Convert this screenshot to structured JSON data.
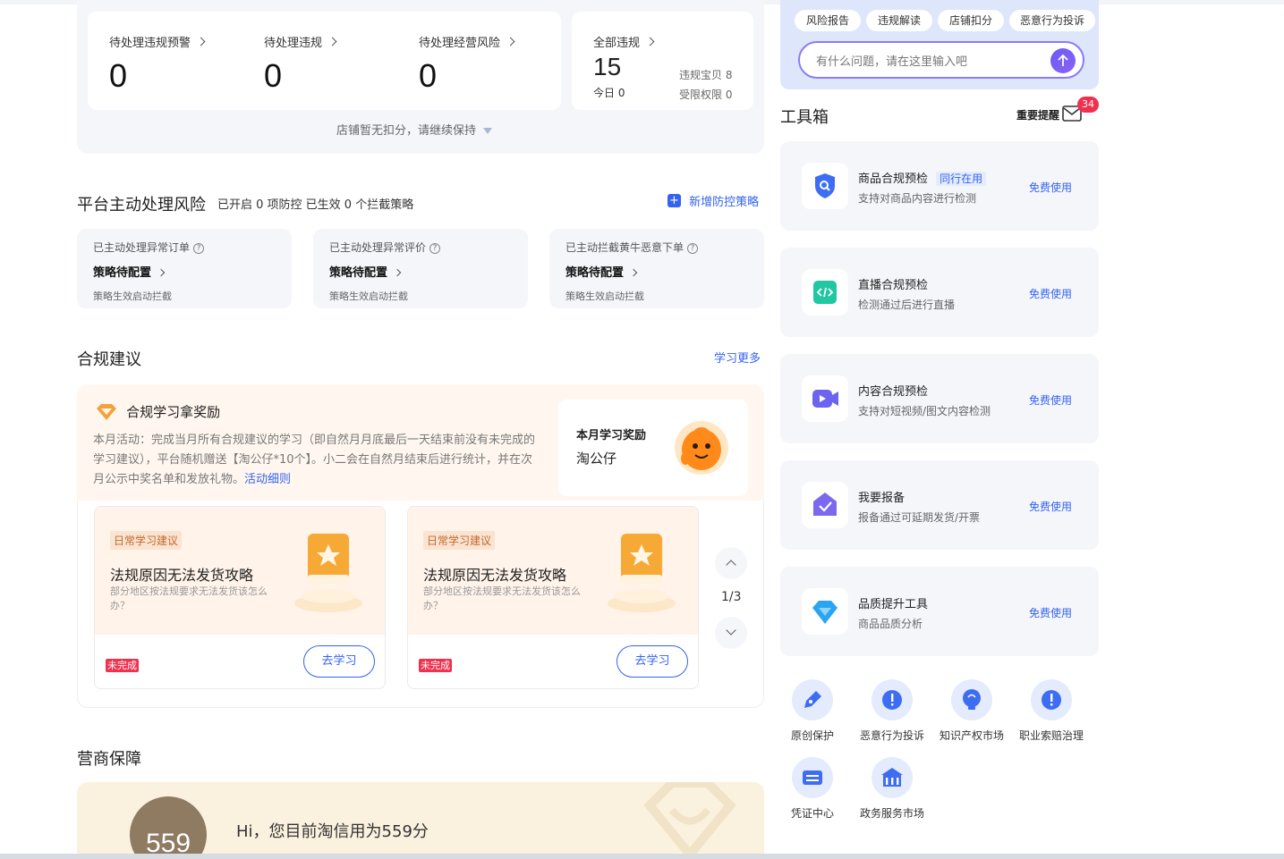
{
  "summary": {
    "cards": [
      {
        "label": "待处理违规预警",
        "value": "0"
      },
      {
        "label": "待处理违规",
        "value": "0"
      },
      {
        "label": "待处理经营风险",
        "value": "0"
      }
    ],
    "all": {
      "label": "全部违规",
      "value": "15",
      "today_label": "今日",
      "today_value": "0",
      "baobei": "违规宝贝 8",
      "limited": "受限权限 0"
    },
    "footer": "店铺暂无扣分，请继续保持"
  },
  "risk": {
    "title": "平台主动处理风险",
    "subtitle": "已开启 0 项防控 已生效 0 个拦截策略",
    "add_label": "新增防控策略",
    "cards": [
      {
        "title": "已主动处理异常订单",
        "status": "策略待配置",
        "desc": "策略生效启动拦截"
      },
      {
        "title": "已主动处理异常评价",
        "status": "策略待配置",
        "desc": "策略生效启动拦截"
      },
      {
        "title": "已主动拦截黄牛恶意下单",
        "status": "策略待配置",
        "desc": "策略生效启动拦截"
      }
    ]
  },
  "advice": {
    "title": "合规建议",
    "more": "学习更多",
    "reward_title": "合规学习拿奖励",
    "reward_text": "本月活动：完成当月所有合规建议的学习（即自然月月底最后一天结束前没有未完成的学习建议），平台随机赠送【淘公仔*10个】。小二会在自然月结束后进行统计，并在次月公示中奖名单和发放礼物。",
    "reward_link": "活动细则",
    "month_reward_label": "本月学习奖励",
    "month_reward_value": "淘公仔",
    "cards": [
      {
        "tag": "日常学习建议",
        "title": "法规原因无法发货攻略",
        "desc": "部分地区按法规要求无法发货该怎么办？",
        "status": "未完成",
        "button": "去学习"
      },
      {
        "tag": "日常学习建议",
        "title": "法规原因无法发货攻略",
        "desc": "部分地区按法规要求无法发货该怎么办？",
        "status": "未完成",
        "button": "去学习"
      }
    ],
    "pager": "1/3"
  },
  "guarantee": {
    "title": "营商保障",
    "score": "559",
    "text": "Hi，您目前淘信用为559分"
  },
  "assistant": {
    "chips": [
      "风险报告",
      "违规解读",
      "店铺扣分",
      "恶意行为投诉"
    ],
    "placeholder": "有什么问题，请在这里输入吧"
  },
  "toolbox": {
    "title": "工具箱",
    "remind_label": "重要提醒",
    "remind_count": "34",
    "tools": [
      {
        "name": "商品合规预检",
        "tag": "同行在用",
        "desc": "支持对商品内容进行检测",
        "action": "免费使用",
        "icon": "shield-search-icon",
        "color": "#3d6df2"
      },
      {
        "name": "直播合规预检",
        "tag": "",
        "desc": "检测通过后进行直播",
        "action": "免费使用",
        "icon": "code-icon",
        "color": "#21c6a3"
      },
      {
        "name": "内容合规预检",
        "tag": "",
        "desc": "支持对短视频/图文内容检测",
        "action": "免费使用",
        "icon": "video-icon",
        "color": "#6c63f0"
      },
      {
        "name": "我要报备",
        "tag": "",
        "desc": "报备通过可延期发货/开票",
        "action": "免费使用",
        "icon": "report-check-icon",
        "color": "#7c68f0"
      },
      {
        "name": "品质提升工具",
        "tag": "",
        "desc": "商品品质分析",
        "action": "免费使用",
        "icon": "diamond-icon",
        "color": "#2aa6f0"
      }
    ]
  },
  "services": [
    {
      "label": "原创保护",
      "icon": "pen-icon"
    },
    {
      "label": "恶意行为投诉",
      "icon": "alert-icon"
    },
    {
      "label": "知识产权市场",
      "icon": "bulb-icon"
    },
    {
      "label": "职业索赔治理",
      "icon": "alert-icon"
    },
    {
      "label": "凭证中心",
      "icon": "voucher-icon"
    },
    {
      "label": "政务服务市场",
      "icon": "gov-icon"
    }
  ]
}
